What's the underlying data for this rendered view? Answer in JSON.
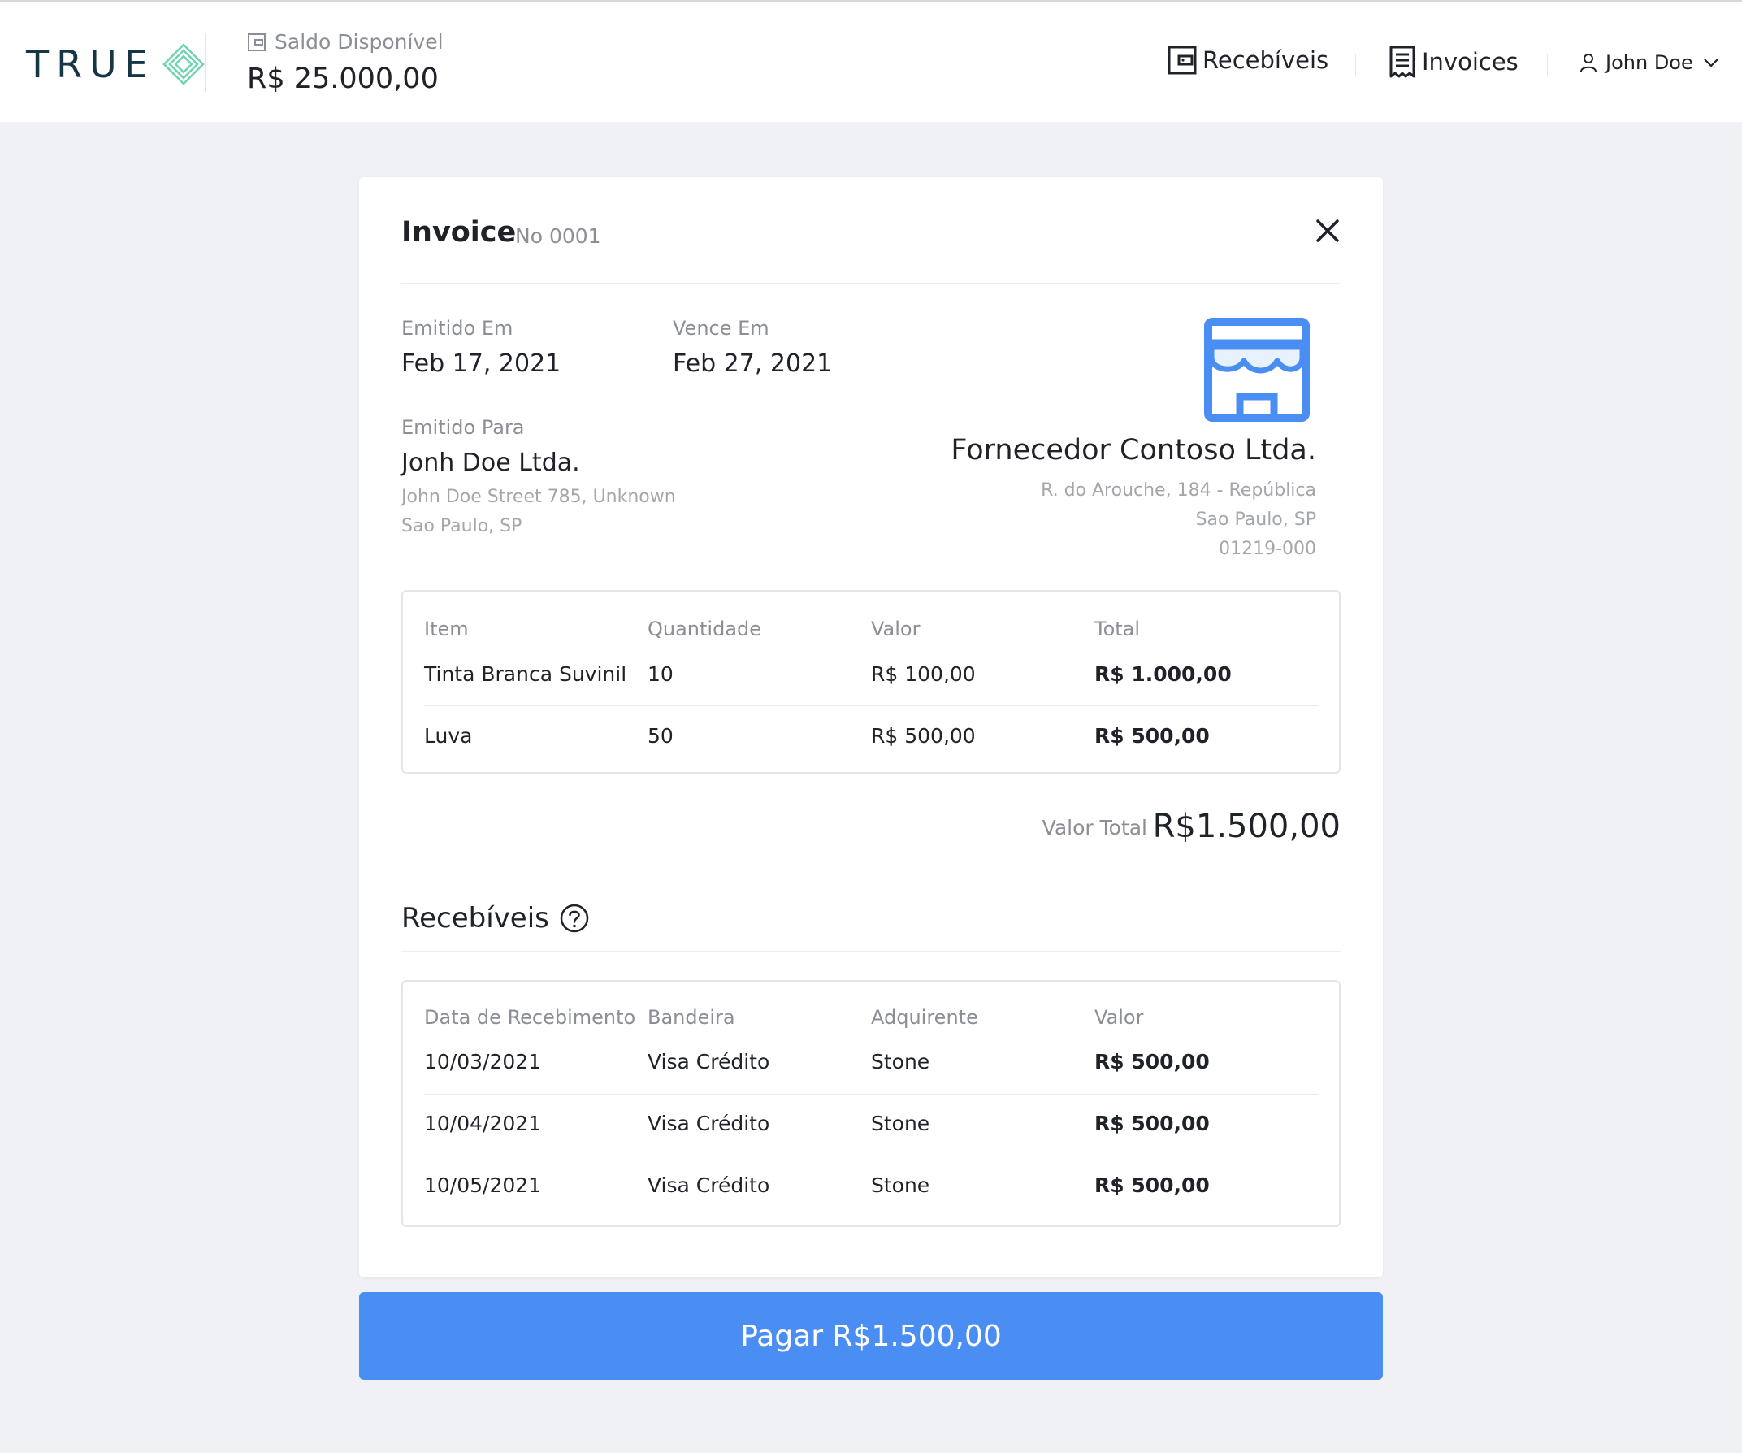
{
  "header": {
    "logo_text": "TRUE",
    "balance_label": "Saldo Disponível",
    "balance_value": "R$ 25.000,00",
    "nav": [
      {
        "label": "Recebíveis",
        "icon": "wallet-icon"
      },
      {
        "label": "Invoices",
        "icon": "document-icon"
      }
    ],
    "user_name": "John Doe"
  },
  "invoice": {
    "title": "Invoice",
    "number": "No 0001",
    "issued_label": "Emitido Em",
    "issued_date": "Feb 17, 2021",
    "due_label": "Vence Em",
    "due_date": "Feb 27, 2021",
    "billed_to_label": "Emitido Para",
    "billed_to_name": "Jonh Doe Ltda.",
    "billed_to_address_1": "John Doe Street 785, Unknown",
    "billed_to_address_2": "Sao Paulo, SP",
    "supplier_name": "Fornecedor Contoso Ltda.",
    "supplier_address_1": "R. do Arouche, 184 - República",
    "supplier_address_2": "Sao Paulo, SP",
    "supplier_address_3": "01219-000",
    "items_table": {
      "headers": [
        "Item",
        "Quantidade",
        "Valor",
        "Total"
      ],
      "rows": [
        [
          "Tinta Branca Suvinil",
          "10",
          "R$ 100,00",
          "R$ 1.000,00"
        ],
        [
          "Luva",
          "50",
          "R$ 500,00",
          "R$ 500,00"
        ]
      ]
    },
    "total_label": "Valor Total",
    "total_value": "R$1.500,00",
    "receivables_title": "Recebíveis",
    "receivables_table": {
      "headers": [
        "Data de Recebimento",
        "Bandeira",
        "Adquirente",
        "Valor"
      ],
      "rows": [
        [
          "10/03/2021",
          "Visa Crédito",
          "Stone",
          "R$ 500,00"
        ],
        [
          "10/04/2021",
          "Visa Crédito",
          "Stone",
          "R$ 500,00"
        ],
        [
          "10/05/2021",
          "Visa Crédito",
          "Stone",
          "R$ 500,00"
        ]
      ]
    }
  },
  "pay_button_label": "Pagar R$1.500,00",
  "colors": {
    "accent": "#4a8ef3",
    "logo_text": "#163645",
    "logo_mark": "#6fd3b0",
    "page_bg": "#f0f1f4"
  }
}
